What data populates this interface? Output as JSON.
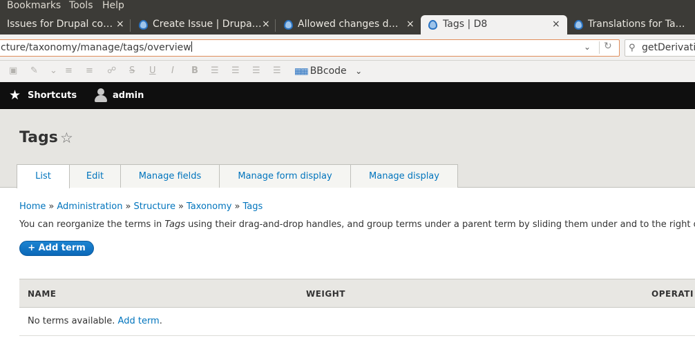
{
  "browser": {
    "menu": [
      "Bookmarks",
      "Tools",
      "Help"
    ],
    "tabs": [
      {
        "title": "Issues for Drupal co…"
      },
      {
        "title": "Create Issue | Drupa…"
      },
      {
        "title": "Allowed changes d…"
      },
      {
        "title": "Tags | D8"
      },
      {
        "title": "Translations for Ta…"
      }
    ],
    "close_glyph": "×",
    "url": "cture/taxonomy/manage/tags/overview",
    "search_value": "getDerivati",
    "editor_toolbar": {
      "format_label": "BBcode"
    }
  },
  "admin_toolbar": {
    "shortcuts_label": "Shortcuts",
    "user_label": "admin"
  },
  "page": {
    "title": "Tags",
    "tabs": [
      "List",
      "Edit",
      "Manage fields",
      "Manage form display",
      "Manage display"
    ],
    "breadcrumb": [
      "Home",
      "Administration",
      "Structure",
      "Taxonomy",
      "Tags"
    ],
    "breadcrumb_sep": "»",
    "help_before": "You can reorganize the terms in ",
    "help_em": "Tags",
    "help_after": " using their drag-and-drop handles, and group terms under a parent term by sliding them under and to the right of",
    "add_term_button": "+ Add term",
    "table": {
      "headers": [
        "NAME",
        "WEIGHT",
        "OPERATI"
      ],
      "empty_text": "No terms available. ",
      "empty_link": "Add term",
      "empty_end": "."
    }
  }
}
